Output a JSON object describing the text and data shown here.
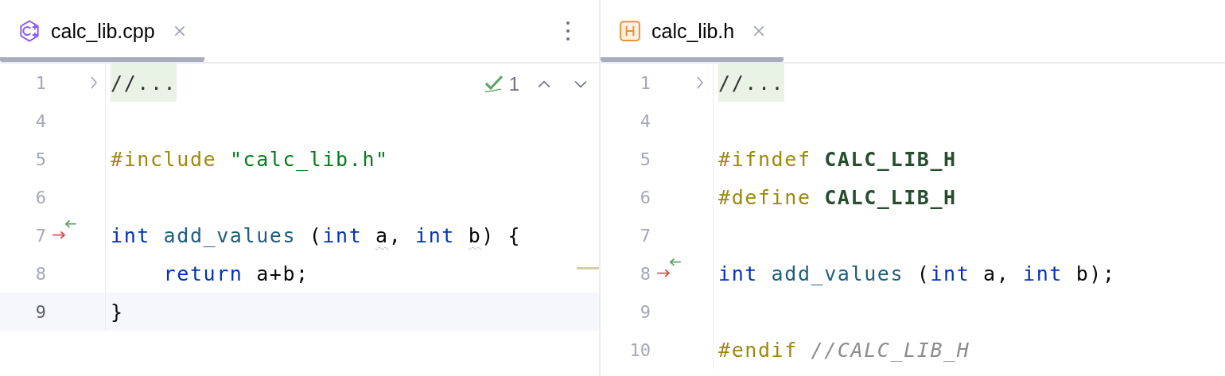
{
  "panes": [
    {
      "tab": {
        "kind": "cpp",
        "label": "calc_lib.cpp",
        "selected": true
      },
      "menu": true,
      "inspection": {
        "count": "1"
      },
      "lines": [
        {
          "number": "1",
          "current": false,
          "kind": "fold",
          "tokens": [
            {
              "text": "//...",
              "kind": "folded"
            }
          ]
        },
        {
          "number": "4",
          "current": false,
          "kind": "plain"
        },
        {
          "number": "5",
          "current": false,
          "kind": "plain",
          "tokens": [
            {
              "text": "#include ",
              "kind": "preproc"
            },
            {
              "text": "\"calc_lib.h\"",
              "kind": "string"
            }
          ]
        },
        {
          "number": "6",
          "current": false,
          "kind": "plain"
        },
        {
          "number": "7",
          "current": false,
          "kind": "override",
          "tokens": [
            {
              "text": "int ",
              "kind": "keyword"
            },
            {
              "text": "add_values",
              "kind": "function"
            },
            {
              "text": " (",
              "kind": "plain"
            },
            {
              "text": "int ",
              "kind": "keyword"
            },
            {
              "text": "a",
              "kind": "unused"
            },
            {
              "text": ", ",
              "kind": "plain"
            },
            {
              "text": "int ",
              "kind": "keyword"
            },
            {
              "text": "b",
              "kind": "unused"
            },
            {
              "text": ") {",
              "kind": "plain"
            }
          ]
        },
        {
          "number": "8",
          "current": false,
          "kind": "plain",
          "stripe": true,
          "tokens": [
            {
              "text": "    return",
              "kind": "keyword"
            },
            {
              "text": " a+b;",
              "kind": "plain"
            }
          ]
        },
        {
          "number": "9",
          "current": true,
          "kind": "plain",
          "tokens": [
            {
              "text": "}",
              "kind": "plain"
            }
          ]
        }
      ]
    },
    {
      "tab": {
        "kind": "header",
        "label": "calc_lib.h",
        "selected": true
      },
      "lines": [
        {
          "number": "1",
          "current": false,
          "kind": "fold",
          "tokens": [
            {
              "text": "//...",
              "kind": "folded"
            }
          ]
        },
        {
          "number": "4",
          "current": false,
          "kind": "plain"
        },
        {
          "number": "5",
          "current": false,
          "kind": "plain",
          "tokens": [
            {
              "text": "#ifndef ",
              "kind": "preproc"
            },
            {
              "text": "CALC_LIB_H",
              "kind": "macro"
            }
          ]
        },
        {
          "number": "6",
          "current": false,
          "kind": "plain",
          "tokens": [
            {
              "text": "#define ",
              "kind": "preproc"
            },
            {
              "text": "CALC_LIB_H",
              "kind": "macro"
            }
          ]
        },
        {
          "number": "7",
          "current": false,
          "kind": "plain"
        },
        {
          "number": "8",
          "current": false,
          "kind": "override",
          "tokens": [
            {
              "text": "int ",
              "kind": "keyword"
            },
            {
              "text": "add_values",
              "kind": "function"
            },
            {
              "text": " (",
              "kind": "plain"
            },
            {
              "text": "int ",
              "kind": "keyword"
            },
            {
              "text": "a, ",
              "kind": "plain"
            },
            {
              "text": "int ",
              "kind": "keyword"
            },
            {
              "text": "b);",
              "kind": "plain"
            }
          ]
        },
        {
          "number": "9",
          "current": false,
          "kind": "plain"
        },
        {
          "number": "10",
          "current": false,
          "kind": "plain",
          "tokens": [
            {
              "text": "#endif ",
              "kind": "preproc"
            },
            {
              "text": "//CALC_LIB_H",
              "kind": "comment"
            }
          ]
        }
      ]
    }
  ]
}
